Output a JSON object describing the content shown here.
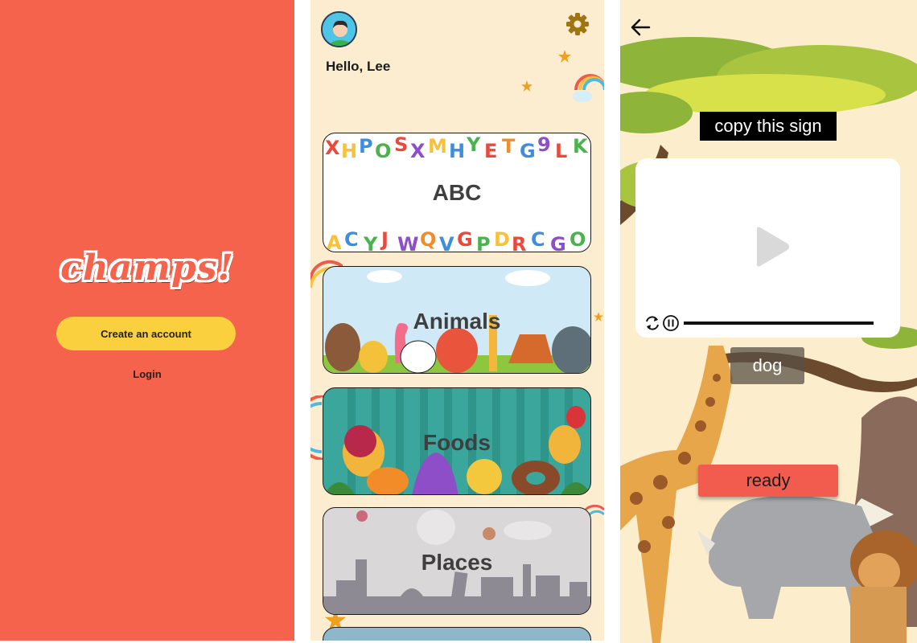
{
  "splash": {
    "logo": "champs!",
    "create_account_label": "Create an account",
    "login_label": "Login"
  },
  "home": {
    "greeting": "Hello, Lee",
    "categories": [
      {
        "label": "ABC"
      },
      {
        "label": "Animals"
      },
      {
        "label": "Foods"
      },
      {
        "label": "Places"
      }
    ]
  },
  "practice": {
    "prompt": "copy this sign",
    "word": "dog",
    "ready_label": "ready"
  },
  "icons": {
    "back": "arrow-left-icon",
    "settings": "gear-icon",
    "play": "play-icon",
    "replay": "replay-icon",
    "pause": "pause-icon"
  },
  "colors": {
    "splash_bg": "#f6634d",
    "create_button": "#fbd03f",
    "home_bg": "#fcecd0",
    "ready_button": "#f15c4e"
  }
}
